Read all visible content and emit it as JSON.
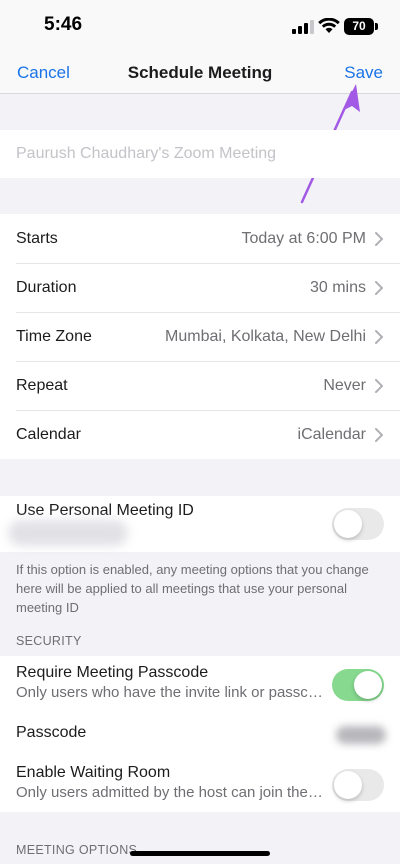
{
  "status_bar": {
    "time": "5:46",
    "battery": "70"
  },
  "nav": {
    "cancel": "Cancel",
    "title": "Schedule Meeting",
    "save": "Save"
  },
  "topic": {
    "placeholder": "Paurush Chaudhary's Zoom Meeting"
  },
  "schedule": {
    "items": [
      {
        "label": "Starts",
        "value": "Today at 6:00 PM"
      },
      {
        "label": "Duration",
        "value": "30 mins"
      },
      {
        "label": "Time Zone",
        "value": "Mumbai, Kolkata, New Delhi"
      },
      {
        "label": "Repeat",
        "value": "Never"
      },
      {
        "label": "Calendar",
        "value": "iCalendar"
      }
    ]
  },
  "pmi": {
    "label": "Use Personal Meeting ID",
    "enabled": false,
    "note": "If this option is enabled, any meeting options that you change here will be applied to all meetings that use your personal meeting ID"
  },
  "security": {
    "header": "SECURITY",
    "passcode_required": {
      "title": "Require Meeting Passcode",
      "desc": "Only users who have the invite link or passcode can join the meeting",
      "enabled": true
    },
    "passcode": {
      "label": "Passcode"
    },
    "waiting_room": {
      "title": "Enable Waiting Room",
      "desc": "Only users admitted by the host can join the meeting",
      "enabled": false
    }
  },
  "meeting_options": {
    "header": "MEETING OPTIONS"
  },
  "colors": {
    "accent": "#1a73e8",
    "toggle_on": "#86d98f",
    "annotation_arrow": "#a259e6"
  }
}
